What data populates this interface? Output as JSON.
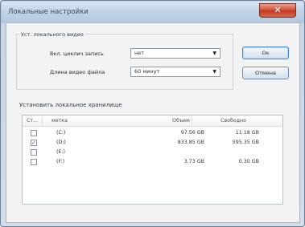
{
  "window": {
    "title": "Локальные настройки",
    "close_glyph": "✕"
  },
  "video_group": {
    "legend": "Уст. локального видео",
    "recording_label": "Вкл. циклич запись",
    "recording_value": "нет",
    "file_length_label": "Длина видео файла",
    "file_length_value": "60 минут"
  },
  "buttons": {
    "ok": "Ок",
    "cancel": "Отмена"
  },
  "storage": {
    "label": "Установить локальное хранилище",
    "columns": [
      "Ст...",
      "метка",
      "Объем",
      "Свободно"
    ],
    "rows": [
      {
        "checked": false,
        "mark": "",
        "label": "(C:)",
        "volume": "97.56 GB",
        "free": "11.18 GB"
      },
      {
        "checked": true,
        "mark": "✓",
        "label": "(D:)",
        "volume": "833.85 GB",
        "free": "595.35 GB"
      },
      {
        "checked": false,
        "mark": "",
        "label": "(E:)",
        "volume": "",
        "free": ""
      },
      {
        "checked": false,
        "mark": "",
        "label": "(F:)",
        "volume": "3.73 GB",
        "free": "0.30 GB"
      }
    ]
  },
  "icons": {
    "dropdown_arrow": "▼"
  }
}
